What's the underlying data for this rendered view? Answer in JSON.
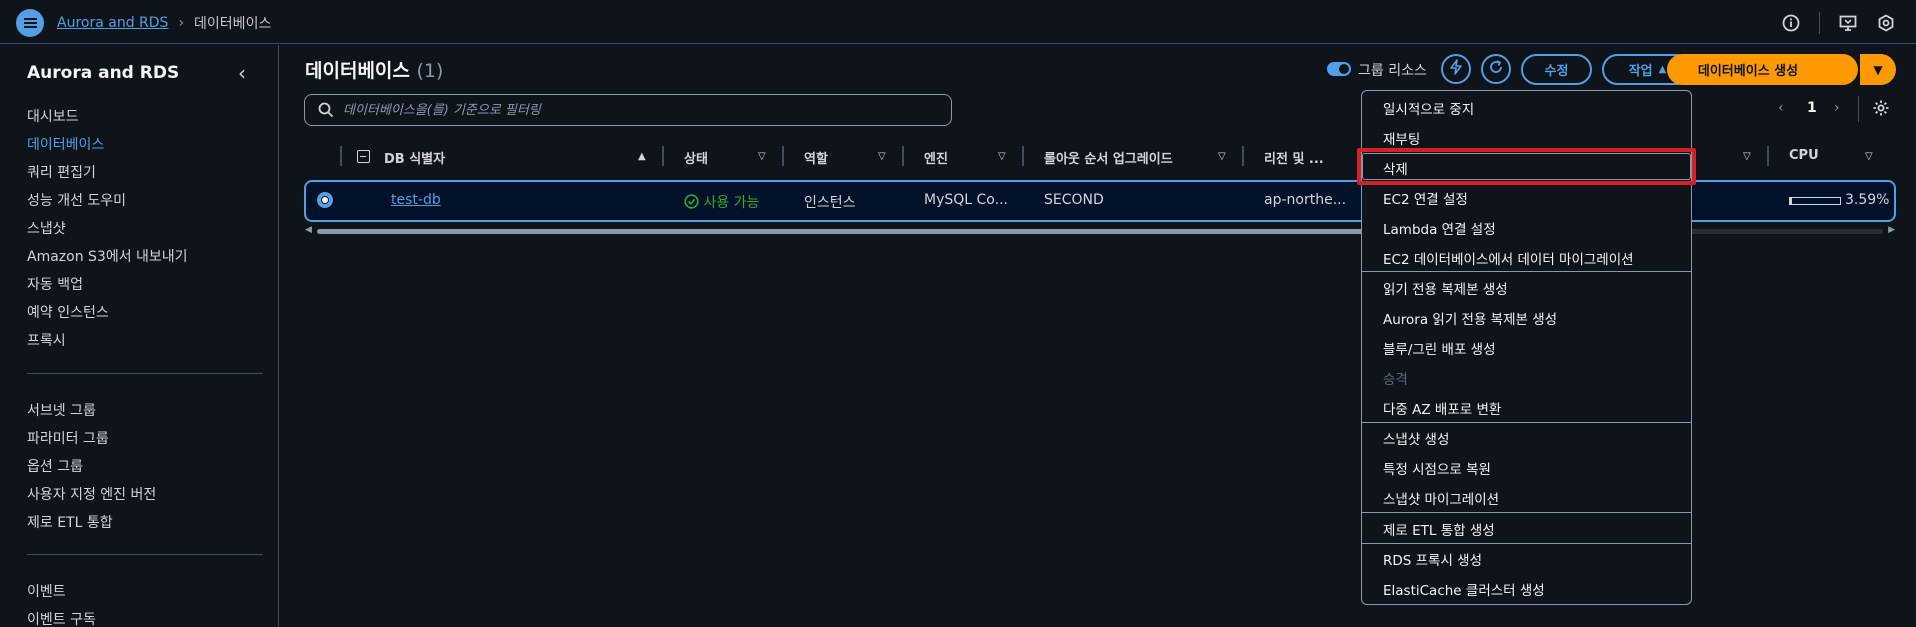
{
  "topbar": {
    "breadcrumb_link": "Aurora and RDS",
    "breadcrumb_current": "데이터베이스"
  },
  "sidebar": {
    "title": "Aurora and RDS",
    "items": [
      "대시보드",
      "데이터베이스",
      "쿼리 편집기",
      "성능 개선 도우미",
      "스냅샷",
      "Amazon S3에서 내보내기",
      "자동 백업",
      "예약 인스턴스",
      "프록시"
    ],
    "items2": [
      "서브넷 그룹",
      "파라미터 그룹",
      "옵션 그룹",
      "사용자 지정 엔진 버전",
      "제로 ETL 통합"
    ],
    "items3": [
      "이벤트",
      "이벤트 구독"
    ]
  },
  "main": {
    "title": "데이터베이스",
    "count": "(1)",
    "group_toggle_label": "그룹 리소스",
    "edit_label": "수정",
    "actions_label": "작업",
    "create_label": "데이터베이스 생성",
    "search_placeholder": "데이터베이스을(를) 기준으로 필터링",
    "page_number": "1"
  },
  "table": {
    "headers": {
      "db_id": "DB 식별자",
      "status": "상태",
      "role": "역할",
      "engine": "엔진",
      "rollout": "롤아웃 순서 업그레이드",
      "region": "리전 및 ...",
      "cpu": "CPU"
    },
    "row": {
      "db_id": "test-db",
      "status": "사용 가능",
      "role": "인스턴스",
      "engine": "MySQL Co...",
      "rollout": "SECOND",
      "region": "ap-northe...",
      "cpu_text": "3.59%",
      "cpu_fraction": 0.0359
    }
  },
  "actions_menu": {
    "group1": [
      "일시적으로 중지",
      "재부팅",
      "삭제",
      "EC2 연결 설정",
      "Lambda 연결 설정",
      "EC2 데이터베이스에서 데이터 마이그레이션"
    ],
    "group2": [
      "읽기 전용 복제본 생성",
      "Aurora 읽기 전용 복제본 생성",
      "블루/그린 배포 생성",
      "승격",
      "다중 AZ 배포로 변환"
    ],
    "group3": [
      "스냅샷 생성",
      "특정 시점으로 복원",
      "스냅샷 마이그레이션"
    ],
    "group4": [
      "제로 ETL 통합 생성"
    ],
    "group5": [
      "RDS 프록시 생성",
      "ElastiCache 클러스터 생성"
    ]
  },
  "colors": {
    "accent": "#539fe5",
    "primary": "#ff9900",
    "success": "#29ad32",
    "highlight": "#d91f26"
  }
}
